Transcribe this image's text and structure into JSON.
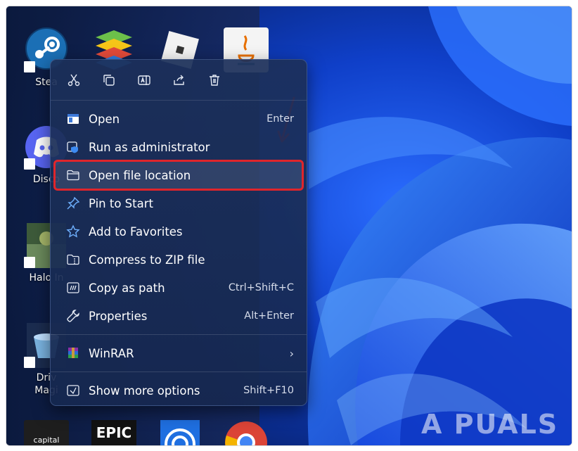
{
  "desktop": {
    "icons": [
      {
        "label": "Stea",
        "icon": "steam-icon"
      },
      {
        "label": "",
        "icon": "bluestacks-icon"
      },
      {
        "label": "",
        "icon": "roblox-icon"
      },
      {
        "label": "",
        "icon": "java-icon"
      },
      {
        "label": "Disco",
        "icon": "discord-icon"
      },
      {
        "label": "Halo In",
        "icon": "halo-icon"
      },
      {
        "label": "Driv",
        "label2": "Magi",
        "icon": "drive-magic-icon"
      },
      {
        "label": "",
        "icon": "capital-icon",
        "text": "capital"
      },
      {
        "label": "",
        "icon": "epic-games-icon",
        "text": "EPIC"
      },
      {
        "label": "",
        "icon": "app-icon"
      },
      {
        "label": "",
        "icon": "chrome-icon"
      }
    ]
  },
  "toolbar": {
    "buttons": [
      {
        "name": "cut",
        "icon": "scissors-icon"
      },
      {
        "name": "copy",
        "icon": "copy-icon"
      },
      {
        "name": "rename",
        "icon": "rename-icon"
      },
      {
        "name": "share",
        "icon": "share-icon"
      },
      {
        "name": "delete",
        "icon": "trash-icon"
      }
    ]
  },
  "menu": {
    "items": [
      {
        "label": "Open",
        "shortcut": "Enter",
        "icon": "window-icon"
      },
      {
        "label": "Run as administrator",
        "shortcut": "",
        "icon": "shield-icon"
      },
      {
        "label": "Open file location",
        "shortcut": "",
        "icon": "folder-icon",
        "highlighted": true
      },
      {
        "label": "Pin to Start",
        "shortcut": "",
        "icon": "pin-icon"
      },
      {
        "label": "Add to Favorites",
        "shortcut": "",
        "icon": "star-icon"
      },
      {
        "label": "Compress to ZIP file",
        "shortcut": "",
        "icon": "zip-icon"
      },
      {
        "label": "Copy as path",
        "shortcut": "Ctrl+Shift+C",
        "icon": "path-icon"
      },
      {
        "label": "Properties",
        "shortcut": "Alt+Enter",
        "icon": "wrench-icon"
      }
    ],
    "winrar": {
      "label": "WinRAR",
      "icon": "winrar-icon"
    },
    "more": {
      "label": "Show more options",
      "shortcut": "Shift+F10",
      "icon": "more-options-icon"
    }
  },
  "watermark": {
    "text": "A  PUALS"
  },
  "colors": {
    "highlight_border": "#e0252b",
    "menu_bg": "#1c305a",
    "wallpaper": "#1240d8"
  }
}
